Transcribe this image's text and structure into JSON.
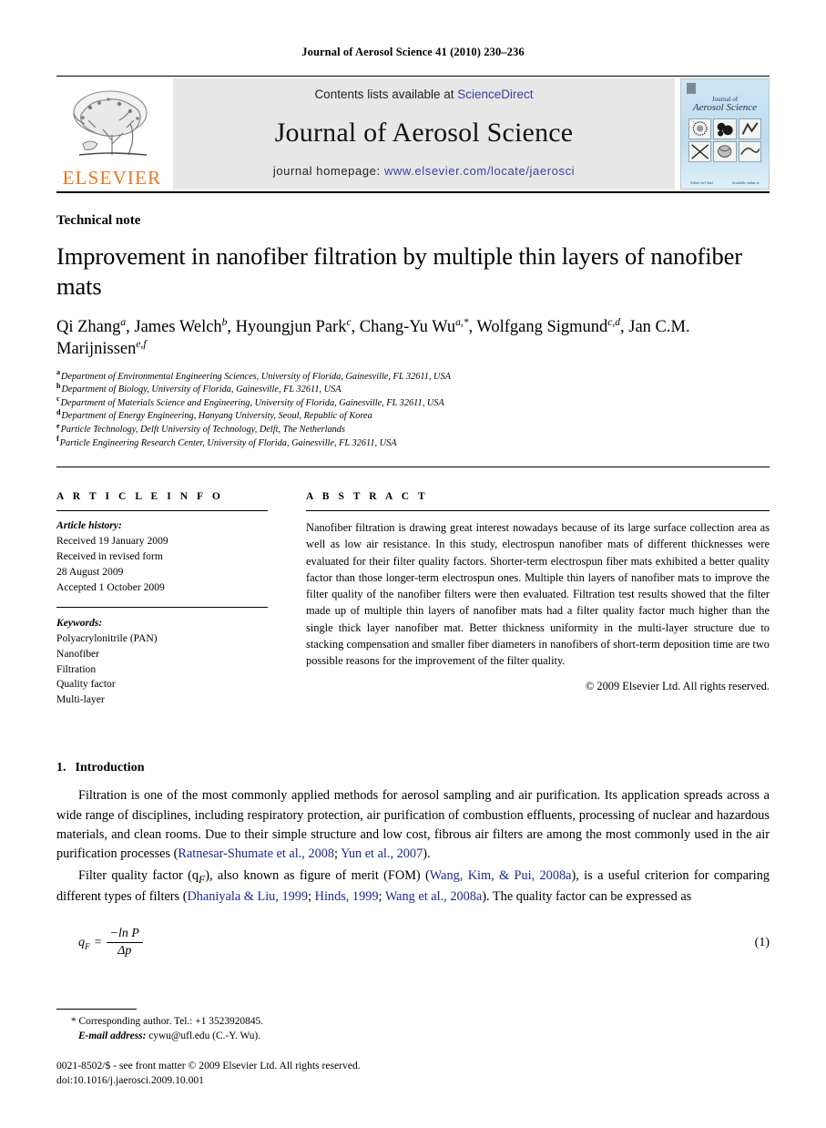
{
  "running_head": "Journal of Aerosol Science 41 (2010) 230–236",
  "journal_header": {
    "contents_prefix": "Contents lists available at ",
    "sciencedirect": "ScienceDirect",
    "journal_title": "Journal of Aerosol Science",
    "homepage_prefix": "journal homepage: ",
    "homepage_url": "www.elsevier.com/locate/jaerosci",
    "elsevier_wordmark": "ELSEVIER",
    "cover": {
      "line1": "Journal of",
      "line2": "Aerosol Science",
      "foot_left": "Editor-in-Chief",
      "foot_right": "Available online at"
    },
    "colors": {
      "link": "#3b3fa0",
      "elsevier_orange": "#E87722",
      "band_gray": "#e7e7e7"
    }
  },
  "article": {
    "type_label": "Technical note",
    "title": "Improvement in nanofiber filtration by multiple thin layers of nanofiber mats",
    "authors": [
      {
        "name": "Qi Zhang",
        "sup": "a",
        "sep": ", "
      },
      {
        "name": "James Welch",
        "sup": "b",
        "sep": ", "
      },
      {
        "name": "Hyoungjun Park",
        "sup": "c",
        "sep": ", "
      },
      {
        "name": "Chang-Yu Wu",
        "sup": "a,*",
        "sep": ", "
      },
      {
        "name": "Wolfgang Sigmund",
        "sup": "c,d",
        "sep": ", "
      },
      {
        "name": "Jan C.M. Marijnissen",
        "sup": "e,f",
        "sep": ""
      }
    ],
    "affiliations": [
      {
        "mark": "a",
        "text": "Department of Environmental Engineering Sciences, University of Florida, Gainesville, FL 32611, USA"
      },
      {
        "mark": "b",
        "text": "Department of Biology, University of Florida, Gainesville, FL 32611, USA"
      },
      {
        "mark": "c",
        "text": "Department of Materials Science and Engineering, University of Florida, Gainesville, FL 32611, USA"
      },
      {
        "mark": "d",
        "text": "Department of Energy Engineering, Hanyang University, Seoul, Republic of Korea"
      },
      {
        "mark": "e",
        "text": "Particle Technology, Delft University of Technology, Delft, The Netherlands"
      },
      {
        "mark": "f",
        "text": "Particle Engineering Research Center, University of Florida, Gainesville, FL 32611, USA"
      }
    ]
  },
  "article_info": {
    "heading": "A R T I C L E   I N F O",
    "history_label": "Article history:",
    "history_lines": [
      "Received 19 January 2009",
      "Received in revised form",
      "28 August 2009",
      "Accepted 1 October 2009"
    ],
    "keywords_label": "Keywords:",
    "keywords": [
      "Polyacrylonitrile (PAN)",
      "Nanofiber",
      "Filtration",
      "Quality factor",
      "Multi-layer"
    ]
  },
  "abstract": {
    "heading": "A B S T R A C T",
    "text": "Nanofiber filtration is drawing great interest nowadays because of its large surface collection area as well as low air resistance. In this study, electrospun nanofiber mats of different thicknesses were evaluated for their filter quality factors. Shorter-term electrospun fiber mats exhibited a better quality factor than those longer-term electrospun ones. Multiple thin layers of nanofiber mats to improve the filter quality of the nanofiber filters were then evaluated. Filtration test results showed that the filter made up of multiple thin layers of nanofiber mats had a filter quality factor much higher than the single thick layer nanofiber mat. Better thickness uniformity in the multi-layer structure due to stacking compensation and smaller fiber diameters in nanofibers of short-term deposition time are two possible reasons for the improvement of the filter quality.",
    "copyright": "© 2009 Elsevier Ltd. All rights reserved."
  },
  "introduction": {
    "number": "1.",
    "title": "Introduction",
    "para1_a": "Filtration is one of the most commonly applied methods for aerosol sampling and air purification. Its application spreads across a wide range of disciplines, including respiratory protection, air purification of combustion effluents, processing of nuclear and hazardous materials, and clean rooms. Due to their simple structure and low cost, fibrous air filters are among the most commonly used in the air purification processes (",
    "para1_cite1": "Ratnesar-Shumate et al., 2008",
    "para1_b": "; ",
    "para1_cite2": "Yun et al., 2007",
    "para1_c": ").",
    "para2_a": "Filter quality factor (q",
    "para2_sub": "F",
    "para2_b": "), also known as figure of merit (FOM) (",
    "para2_cite1": "Wang, Kim, & Pui, 2008a",
    "para2_c": "), is a useful criterion for comparing different types of filters (",
    "para2_cite2": "Dhaniyala & Liu, 1999",
    "para2_d": "; ",
    "para2_cite3": "Hinds, 1999",
    "para2_e": "; ",
    "para2_cite4": "Wang et al., 2008a",
    "para2_f": "). The quality factor can be expressed as"
  },
  "equation": {
    "lhs_symbol": "q",
    "lhs_sub": "F",
    "equals": "=",
    "numerator": "−ln P",
    "denominator": "Δp",
    "number": "(1)"
  },
  "footnotes": {
    "corresponding": "* Corresponding author. Tel.: +1 3523920845.",
    "email_label": "E-mail address:",
    "email_value": " cywu@ufl.edu (C.-Y. Wu).",
    "issn_line": "0021-8502/$ - see front matter © 2009 Elsevier Ltd. All rights reserved.",
    "doi_line": "doi:10.1016/j.jaerosci.2009.10.001"
  }
}
